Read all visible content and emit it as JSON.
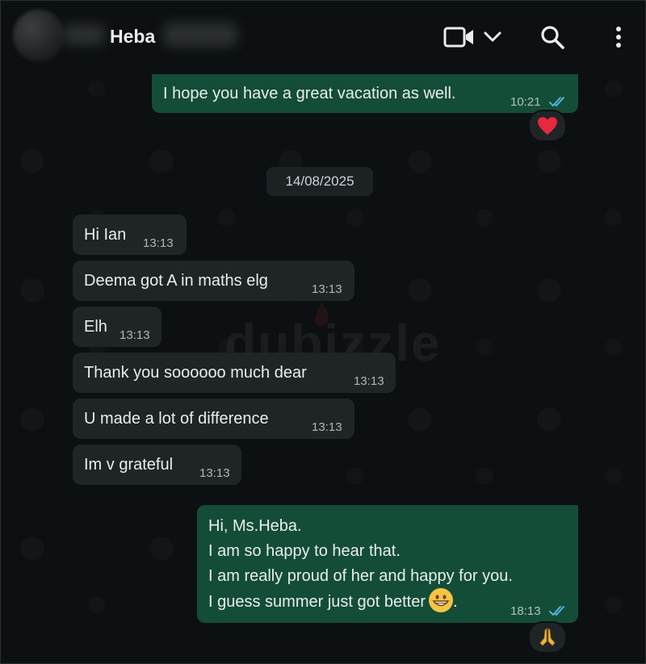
{
  "header": {
    "contact_name": "Heba",
    "icons": [
      "video-call-icon",
      "chevron-down-icon",
      "search-icon",
      "menu-icon"
    ]
  },
  "messages": [
    {
      "direction": "outgoing",
      "text": "I hope you have a great vacation as well.",
      "time": "10:21",
      "status": "read",
      "reaction": "heart"
    },
    {
      "type": "date",
      "text": "14/08/2025"
    },
    {
      "direction": "incoming",
      "text": "Hi Ian",
      "time": "13:13"
    },
    {
      "direction": "incoming",
      "text": "Deema got A in maths elg",
      "time": "13:13"
    },
    {
      "direction": "incoming",
      "text": "Elh",
      "time": "13:13"
    },
    {
      "direction": "incoming",
      "text": "Thank you soooooo much dear",
      "time": "13:13"
    },
    {
      "direction": "incoming",
      "text": "U made a lot of difference",
      "time": "13:13"
    },
    {
      "direction": "incoming",
      "text": "Im v grateful",
      "time": "13:13"
    },
    {
      "direction": "outgoing",
      "lines": [
        "Hi, Ms.Heba.",
        "I am so happy to hear that.",
        "I am really proud of her and happy for you.",
        "I guess summer just got better"
      ],
      "line_end_emoji": "grinning-face",
      "line_end_after": ".",
      "time": "18:13",
      "status": "read",
      "reaction": "folded-hands"
    }
  ],
  "watermark": "dubizzle",
  "colors": {
    "outgoing_bubble": "#144d37",
    "incoming_bubble": "#1f2426",
    "read_ticks": "#53bdeb",
    "background": "#0c1012"
  }
}
